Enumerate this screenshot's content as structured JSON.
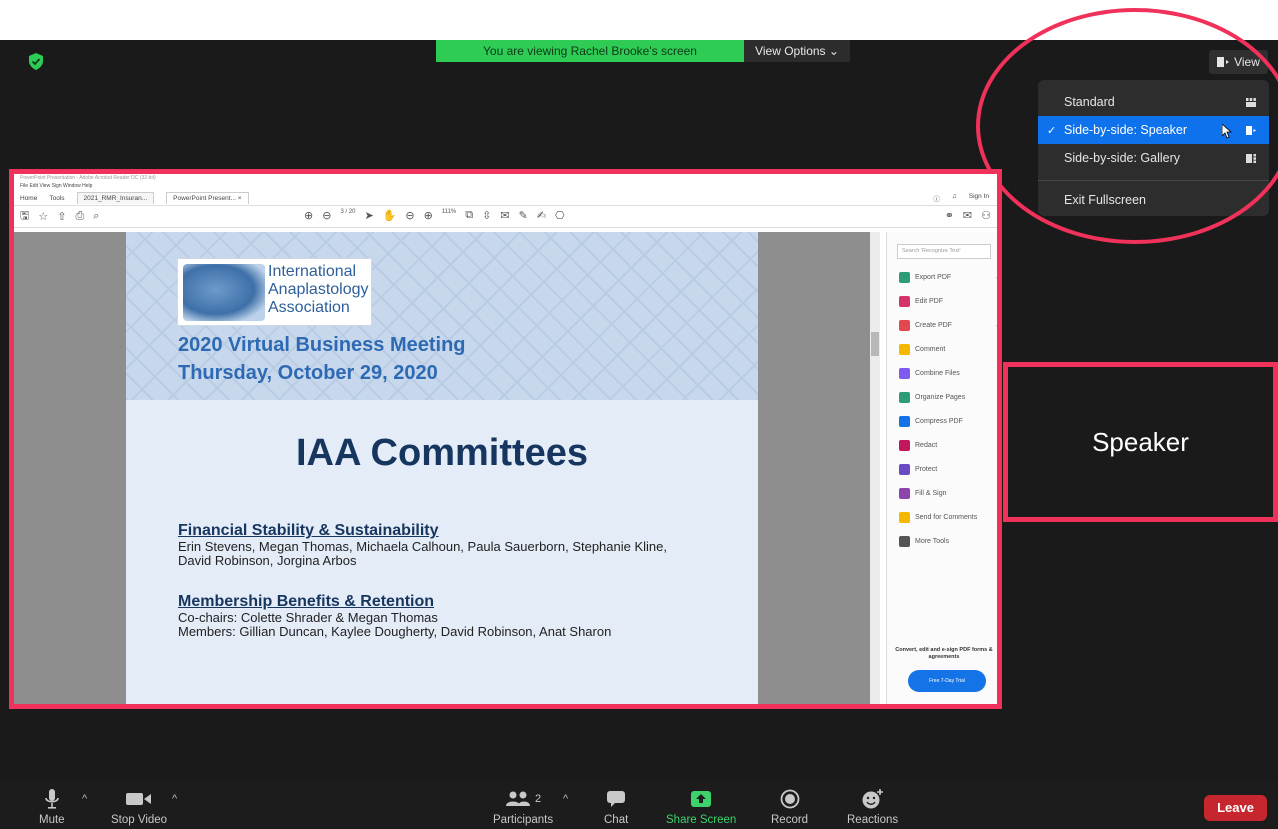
{
  "meeting": {
    "banner_text": "You are viewing Rachel Brooke's screen",
    "view_options_label": "View Options ⌄",
    "view_button_label": "View"
  },
  "view_menu": {
    "items": [
      {
        "label": "Standard",
        "selected": false
      },
      {
        "label": "Side-by-side: Speaker",
        "selected": true
      },
      {
        "label": "Side-by-side: Gallery",
        "selected": false
      }
    ],
    "exit_label": "Exit Fullscreen",
    "check_mark": "✓"
  },
  "shared_window": {
    "app_title": "PowerPoint Presentation - Adobe Acrobat Reader DC (32-bit)",
    "menu_bar": "File  Edit  View  Sign  Window  Help",
    "tabs": [
      "Home",
      "Tools",
      "2021_RMR_Insuran...",
      "PowerPoint Present...  ×"
    ],
    "sign_in": "Sign In",
    "page_indicator": "3 / 20",
    "zoom": "111%",
    "search_placeholder": "Search 'Recognize Text'",
    "tools": [
      {
        "label": "Export PDF",
        "color": "#2d9d78",
        "chevron": true
      },
      {
        "label": "Edit PDF",
        "color": "#d6336c",
        "chevron": false
      },
      {
        "label": "Create PDF",
        "color": "#e34850",
        "chevron": true
      },
      {
        "label": "Comment",
        "color": "#f5b800",
        "chevron": false
      },
      {
        "label": "Combine Files",
        "color": "#7e5bef",
        "chevron": false
      },
      {
        "label": "Organize Pages",
        "color": "#2d9d78",
        "chevron": false
      },
      {
        "label": "Compress PDF",
        "color": "#1473e6",
        "chevron": false
      },
      {
        "label": "Redact",
        "color": "#c2185b",
        "chevron": false
      },
      {
        "label": "Protect",
        "color": "#6a4bc4",
        "chevron": false
      },
      {
        "label": "Fill & Sign",
        "color": "#8e44ad",
        "chevron": false
      },
      {
        "label": "Send for Comments",
        "color": "#f5b800",
        "chevron": false
      },
      {
        "label": "More Tools",
        "color": "#555555",
        "chevron": false
      }
    ],
    "promo_text": "Convert, edit and e-sign PDF forms & agreements",
    "trial_button": "Free 7-Day Trial"
  },
  "slide": {
    "logo_lines": [
      "International",
      "Anaplastology",
      "Association"
    ],
    "header_line1": "2020 Virtual Business Meeting",
    "header_line2": "Thursday, October 29, 2020",
    "title": "IAA Committees",
    "committees": [
      {
        "heading": "Financial Stability & Sustainability",
        "lines": [
          "Erin Stevens, Megan Thomas, Michaela Calhoun, Paula Sauerborn, Stephanie Kline,",
          "David Robinson, Jorgina Arbos"
        ]
      },
      {
        "heading": "Membership Benefits & Retention",
        "lines": [
          "Co-chairs: Colette Shrader & Megan Thomas",
          "Members: Gillian Duncan, Kaylee Dougherty, David Robinson, Anat Sharon"
        ]
      }
    ]
  },
  "speaker": {
    "name": "Speaker"
  },
  "toolbar": {
    "mute": "Mute",
    "stop_video": "Stop Video",
    "participants": "Participants",
    "participant_count": "2",
    "chat": "Chat",
    "share_screen": "Share Screen",
    "record": "Record",
    "reactions": "Reactions",
    "leave": "Leave",
    "caret": "^"
  },
  "colors": {
    "annotation": "#f0325a",
    "banner_green": "#2ecc55",
    "menu_selected": "#0e72ed",
    "leave_red": "#c6262e"
  }
}
